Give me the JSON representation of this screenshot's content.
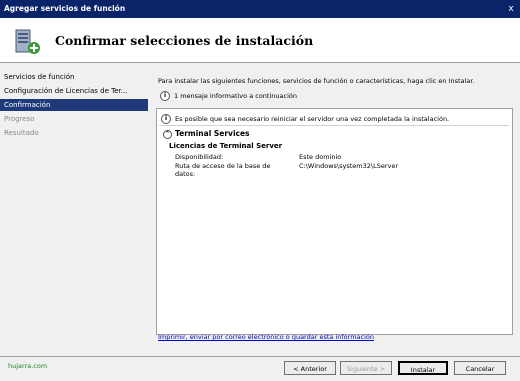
{
  "window": {
    "title": "Agregar servicios de función",
    "close_glyph": "x"
  },
  "header": {
    "title": "Confirmar selecciones de instalación",
    "icon": "server-install-icon"
  },
  "sidebar": {
    "items": [
      {
        "label": "Servicios de función",
        "state": "normal"
      },
      {
        "label": "Configuración de Licencias de Ter...",
        "state": "normal"
      },
      {
        "label": "Confirmación",
        "state": "active"
      },
      {
        "label": "Progreso",
        "state": "disabled"
      },
      {
        "label": "Resultado",
        "state": "disabled"
      }
    ]
  },
  "main": {
    "instruction": "Para instalar las siguientes funciones, servicios de función o características, haga clic en Instalar.",
    "info_message": "1 mensaje informativo a continuación",
    "panel": {
      "warning": "Es posible que sea necesario reiniciar el servidor una vez completada la instalación.",
      "section_title": "Terminal Services",
      "subsection_title": "Licencias de Terminal Server",
      "rows": [
        {
          "label": "Disponibilidad:",
          "value": "Este dominio"
        },
        {
          "label": "Ruta de acceso de la base de datos:",
          "value": "C:\\Windows\\system32\\LServer"
        }
      ]
    },
    "link": "Imprimir, enviar por correo electrónico o guardar esta información"
  },
  "footer": {
    "logo_text": "hujarra.com",
    "buttons": {
      "back": "< Anterior",
      "next": "Siguiente >",
      "install": "Instalar",
      "cancel": "Cancelar"
    }
  },
  "colors": {
    "titlebar": "#0a246a",
    "active_nav": "#1f3a7a",
    "link": "#0000cc"
  }
}
